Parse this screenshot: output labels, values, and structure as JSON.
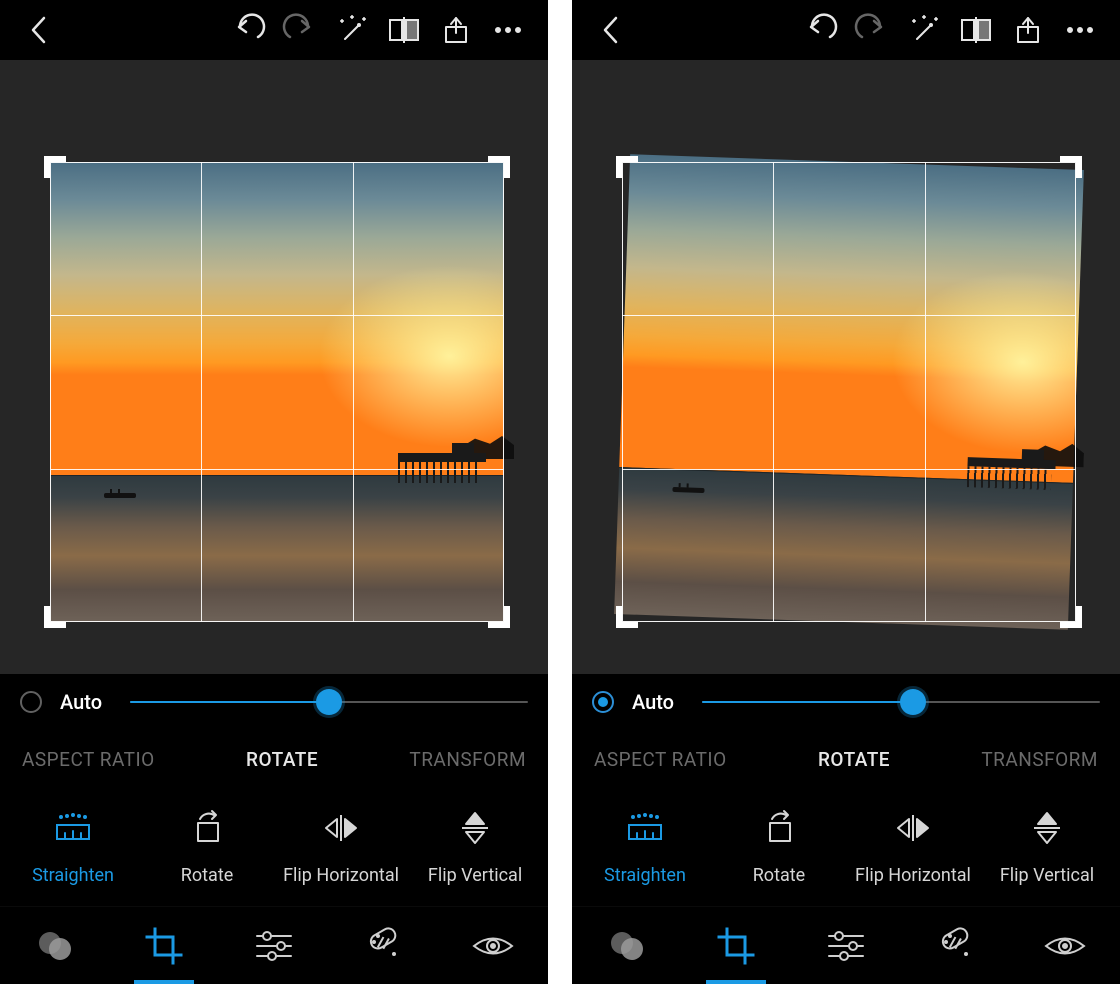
{
  "accent": "#1b9ae4",
  "panels": {
    "left": {
      "auto_label": "Auto",
      "auto_on": false,
      "slider_percent": 50,
      "tabs": {
        "aspect": "ASPECT RATIO",
        "rotate": "ROTATE",
        "transform": "TRANSFORM",
        "active": "rotate"
      },
      "tools": {
        "straighten": "Straighten",
        "rotate": "Rotate",
        "flip_h": "Flip Horizontal",
        "flip_v": "Flip Vertical",
        "active": "straighten"
      },
      "photo_rotated": false
    },
    "right": {
      "auto_label": "Auto",
      "auto_on": true,
      "slider_percent": 53,
      "tabs": {
        "aspect": "ASPECT RATIO",
        "rotate": "ROTATE",
        "transform": "TRANSFORM",
        "active": "rotate"
      },
      "tools": {
        "straighten": "Straighten",
        "rotate": "Rotate",
        "flip_h": "Flip Horizontal",
        "flip_v": "Flip Vertical",
        "active": "straighten"
      },
      "photo_rotated": true
    }
  },
  "toolbar_icons": [
    "back",
    "undo",
    "redo",
    "wand",
    "compare",
    "share",
    "more"
  ],
  "bottom_icons": [
    "filters",
    "crop",
    "adjust",
    "heal",
    "redeye"
  ],
  "bottom_active": "crop"
}
